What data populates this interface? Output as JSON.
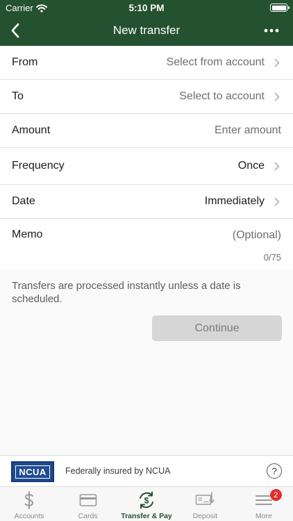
{
  "status_bar": {
    "carrier": "Carrier",
    "time": "5:10 PM"
  },
  "nav": {
    "title": "New transfer",
    "back_icon": "chevron-left-icon",
    "menu_icon": "ellipsis-icon"
  },
  "form": {
    "from": {
      "label": "From",
      "value": "Select from account"
    },
    "to": {
      "label": "To",
      "value": "Select to account"
    },
    "amount": {
      "label": "Amount",
      "placeholder": "Enter amount"
    },
    "frequency": {
      "label": "Frequency",
      "value": "Once"
    },
    "date": {
      "label": "Date",
      "value": "Immediately"
    },
    "memo": {
      "label": "Memo",
      "placeholder": "(Optional)",
      "counter": "0/75"
    }
  },
  "info_text": "Transfers are processed instantly unless a date is scheduled.",
  "continue_label": "Continue",
  "ncua": {
    "logo_text": "NCUA",
    "text": "Federally insured by NCUA",
    "help_icon_glyph": "?"
  },
  "tabs": [
    {
      "label": "Accounts",
      "icon": "dollar-icon",
      "active": false
    },
    {
      "label": "Cards",
      "icon": "card-icon",
      "active": false
    },
    {
      "label": "Transfer & Pay",
      "icon": "transfer-icon",
      "active": true
    },
    {
      "label": "Deposit",
      "icon": "check-deposit-icon",
      "active": false
    },
    {
      "label": "More",
      "icon": "menu-icon",
      "active": false,
      "badge": "2"
    }
  ],
  "colors": {
    "header": "#24512f",
    "accent": "#24512f",
    "badge": "#e0302b",
    "button_disabled": "#d6d6d6",
    "ncua_blue": "#1e4c8f"
  }
}
